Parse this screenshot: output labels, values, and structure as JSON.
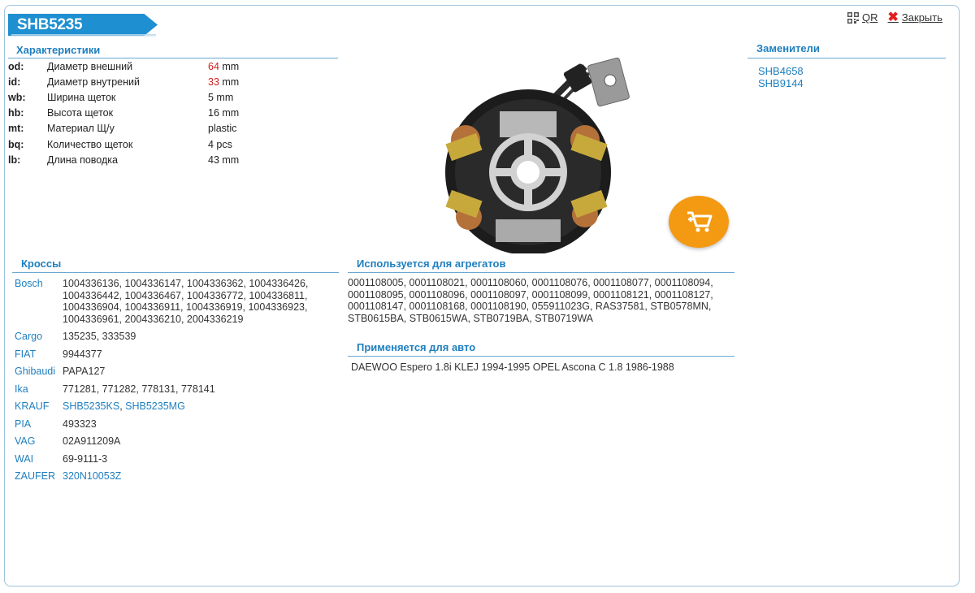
{
  "header": {
    "title": "SHB5235",
    "qr_label": "QR",
    "close_label": "Закрыть"
  },
  "colors": {
    "accent": "#1e8fd0",
    "link": "#1e7fbf",
    "highlight": "#d01f1f",
    "cart": "#f39a12"
  },
  "specs": {
    "heading": "Характеристики",
    "rows": [
      {
        "key": "od:",
        "label": "Диаметр внешний",
        "value": "64",
        "unit": " mm",
        "highlight": true
      },
      {
        "key": "id:",
        "label": "Диаметр внутрений",
        "value": "33",
        "unit": " mm",
        "highlight": true
      },
      {
        "key": "wb:",
        "label": "Ширина щеток",
        "value": "5",
        "unit": " mm",
        "highlight": false
      },
      {
        "key": "hb:",
        "label": "Высота щеток",
        "value": "16",
        "unit": " mm",
        "highlight": false
      },
      {
        "key": "mt:",
        "label": "Материал Щ/у",
        "value": "plastic",
        "unit": "",
        "highlight": false
      },
      {
        "key": "bq:",
        "label": "Количество щеток",
        "value": "4",
        "unit": " pcs",
        "highlight": false
      },
      {
        "key": "lb:",
        "label": "Длина поводка",
        "value": "43",
        "unit": " mm",
        "highlight": false
      }
    ]
  },
  "substitutes": {
    "heading": "Заменители",
    "items": [
      "SHB4658",
      "SHB9144"
    ]
  },
  "crosses": {
    "heading": "Кроссы",
    "rows": [
      {
        "brand": "Bosch",
        "values": "1004336136, 1004336147, 1004336362, 1004336426, 1004336442, 1004336467, 1004336772, 1004336811, 1004336904, 1004336911, 1004336919, 1004336923, 1004336961, 2004336210, 2004336219",
        "links": []
      },
      {
        "brand": "Cargo",
        "values": "135235, 333539",
        "links": []
      },
      {
        "brand": "FIAT",
        "values": "9944377",
        "links": []
      },
      {
        "brand": "Ghibaudi",
        "values": "PAPA127",
        "links": []
      },
      {
        "brand": "Ika",
        "values": "771281, 771282, 778131, 778141",
        "links": []
      },
      {
        "brand": "KRAUF",
        "values": "",
        "links": [
          "SHB5235KS",
          "SHB5235MG"
        ]
      },
      {
        "brand": "PIA",
        "values": "493323",
        "links": []
      },
      {
        "brand": "VAG",
        "values": "02A911209A",
        "links": []
      },
      {
        "brand": "WAI",
        "values": "69-9111-3",
        "links": []
      },
      {
        "brand": "ZAUFER",
        "values": "",
        "links": [
          "320N10053Z"
        ]
      }
    ]
  },
  "aggregates": {
    "heading": "Используется для агрегатов",
    "text": "0001108005, 0001108021, 0001108060, 0001108076, 0001108077, 0001108094, 0001108095, 0001108096, 0001108097, 0001108099, 0001108121, 0001108127, 0001108147, 0001108168, 0001108190, 055911023G, RAS37581, STB0578MN, STB0615BA, STB0615WA, STB0719BA, STB0719WA"
  },
  "vehicles": {
    "heading": "Применяется для авто",
    "text": "DAEWOO Espero 1.8i KLEJ 1994-1995 OPEL Ascona C 1.8 1986-1988"
  },
  "icons": {
    "qr": "qr-icon",
    "close": "close-icon",
    "cart": "add-to-cart-icon"
  }
}
